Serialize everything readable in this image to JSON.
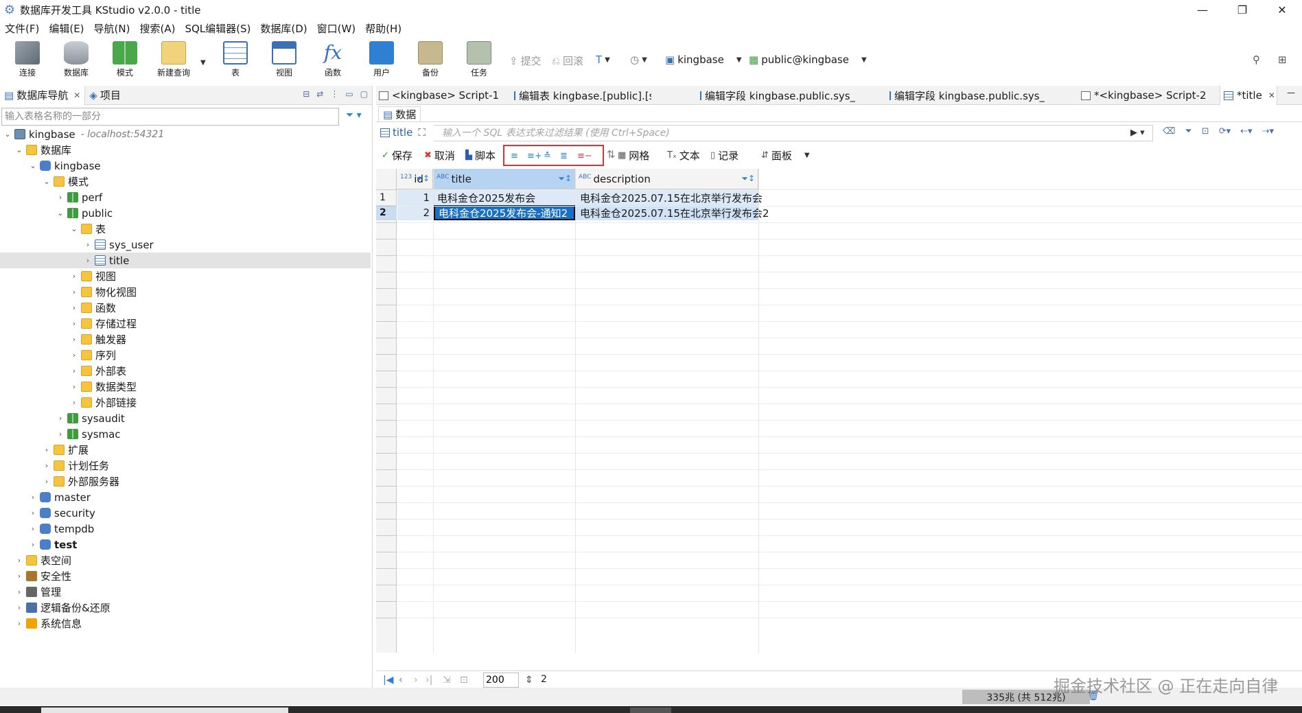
{
  "window": {
    "title": "数据库开发工具 KStudio v2.0.0 - title",
    "minimize": "—",
    "maximize": "❐",
    "close": "✕"
  },
  "menu": [
    "文件(F)",
    "编辑(E)",
    "导航(N)",
    "搜索(A)",
    "SQL编辑器(S)",
    "数据库(D)",
    "窗口(W)",
    "帮助(H)"
  ],
  "toolbar": {
    "buttons": [
      "连接",
      "数据库",
      "模式",
      "新建查询",
      "表",
      "视图",
      "函数",
      "用户",
      "备份",
      "任务"
    ],
    "commit": "提交",
    "rollback": "回滚",
    "datasource": "kingbase",
    "schema": "public@kingbase"
  },
  "left_panel": {
    "tabs": [
      "数据库导航",
      "项目"
    ],
    "search_placeholder": "输入表格名称的一部分",
    "tree": {
      "root": "kingbase",
      "root_host": "- localhost:54321",
      "databases_folder": "数据库",
      "db_kingbase": "kingbase",
      "schemas_folder": "模式",
      "schema_perf": "perf",
      "schema_public": "public",
      "tables_folder": "表",
      "table_sys_user": "sys_user",
      "table_title": "title",
      "views": "视图",
      "mviews": "物化视图",
      "functions": "函数",
      "procedures": "存储过程",
      "triggers": "触发器",
      "sequences": "序列",
      "foreign_tables": "外部表",
      "data_types": "数据类型",
      "foreign_links": "外部链接",
      "schema_sysaudit": "sysaudit",
      "schema_sysmac": "sysmac",
      "extensions": "扩展",
      "scheduled_tasks": "计划任务",
      "foreign_servers": "外部服务器",
      "db_master": "master",
      "db_security": "security",
      "db_tempdb": "tempdb",
      "db_test": "test",
      "tablespaces": "表空间",
      "security": "安全性",
      "management": "管理",
      "backup_restore": "逻辑备份&还原",
      "system_info": "系统信息"
    }
  },
  "editor": {
    "tabs": [
      "<kingbase> Script-1",
      "编辑表 kingbase.[public].[sys...",
      "编辑字段 kingbase.public.sys_...",
      "编辑字段 kingbase.public.sys_...",
      "*<kingbase> Script-2",
      "*title"
    ],
    "subtab": "数据",
    "table_name": "title",
    "filter_placeholder": "输入一个 SQL 表达式来过滤结果 (使用 Ctrl+Space)",
    "data_toolbar": {
      "save": "保存",
      "cancel": "取消",
      "script": "脚本",
      "grid": "网格",
      "text": "文本",
      "record": "记录",
      "panel": "面板"
    },
    "columns": [
      {
        "type": "123",
        "name": "id"
      },
      {
        "type": "ABC",
        "name": "title"
      },
      {
        "type": "ABC",
        "name": "description"
      }
    ],
    "rows": [
      {
        "num": "1",
        "id": "1",
        "title": "电科金仓2025发布会",
        "description": "电科金仓2025.07.15在北京举行发布会"
      },
      {
        "num": "2",
        "id": "2",
        "title": "电科金仓2025发布会-通知2",
        "description": "电科金仓2025.07.15在北京举行发布会2"
      }
    ],
    "pager": {
      "page_size": "200",
      "count": "2"
    }
  },
  "status": {
    "memory": "335兆 (共 512兆)"
  },
  "watermark": "掘金技术社区 @ 正在走向自律"
}
